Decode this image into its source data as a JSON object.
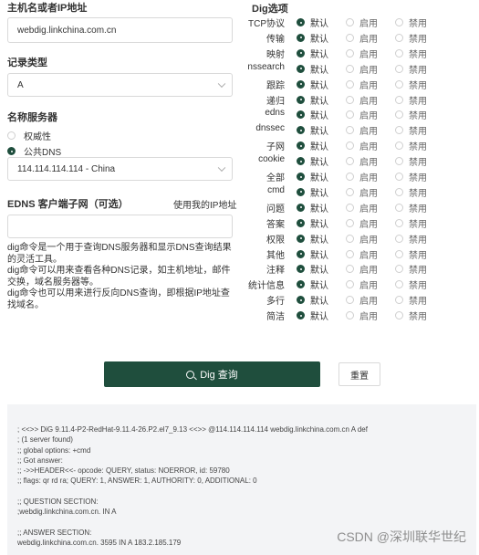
{
  "host": {
    "label": "主机名或者IP地址",
    "value": "webdig.linkchina.com.cn"
  },
  "record": {
    "label": "记录类型",
    "value": "A"
  },
  "nameserver": {
    "label": "名称服务器",
    "options": [
      {
        "label": "权威性",
        "checked": false
      },
      {
        "label": "公共DNS",
        "checked": true
      }
    ],
    "selected": "114.114.114.114 - China"
  },
  "edns": {
    "label": "EDNS 客户端子网（可选）",
    "link": "使用我的IP地址",
    "value": ""
  },
  "description": [
    "dig命令是一个用于查询DNS服务器和显示DNS查询结果的灵活工具。",
    "dig命令可以用来查看各种DNS记录，如主机地址，邮件交换，域名服务器等。",
    "dig命令也可以用来进行反向DNS查询，即根据IP地址查找域名。"
  ],
  "dig_options": {
    "title": "Dig选项",
    "option_labels": [
      "默认",
      "启用",
      "禁用"
    ],
    "rows": [
      {
        "name": "TCP协议",
        "selected": 0
      },
      {
        "name": "传输",
        "selected": 0
      },
      {
        "name": "映射",
        "selected": 0
      },
      {
        "name": "nssearch",
        "selected": 0
      },
      {
        "name": "跟踪",
        "selected": 0
      },
      {
        "name": "递归",
        "selected": 0
      },
      {
        "name": "edns",
        "selected": 0
      },
      {
        "name": "dnssec",
        "selected": 0
      },
      {
        "name": "子网",
        "selected": 0
      },
      {
        "name": "cookie",
        "selected": 0
      },
      {
        "name": "全部",
        "selected": 0
      },
      {
        "name": "cmd",
        "selected": 0
      },
      {
        "name": "问题",
        "selected": 0
      },
      {
        "name": "答案",
        "selected": 0
      },
      {
        "name": "权限",
        "selected": 0
      },
      {
        "name": "其他",
        "selected": 0
      },
      {
        "name": "注释",
        "selected": 0
      },
      {
        "name": "统计信息",
        "selected": 0
      },
      {
        "name": "多行",
        "selected": 0
      },
      {
        "name": "简洁",
        "selected": 0
      }
    ]
  },
  "buttons": {
    "dig": "Dig 查询",
    "reset": "重置"
  },
  "result_lines": [
    "; <<>> DiG 9.11.4-P2-RedHat-9.11.4-26.P2.el7_9.13 <<>> @114.114.114.114 webdig.linkchina.com.cn A def",
    "; (1 server found)",
    ";; global options: +cmd",
    ";; Got answer:",
    ";; ->>HEADER<<- opcode: QUERY, status: NOERROR, id: 59780",
    ";; flags: qr rd ra; QUERY: 1, ANSWER: 1, AUTHORITY: 0, ADDITIONAL: 0",
    "",
    ";; QUESTION SECTION:",
    ";webdig.linkchina.com.cn. IN A",
    "",
    ";; ANSWER SECTION:",
    "webdig.linkchina.com.cn. 3595 IN A 183.2.185.179"
  ],
  "watermark": "CSDN @深圳联华世纪"
}
